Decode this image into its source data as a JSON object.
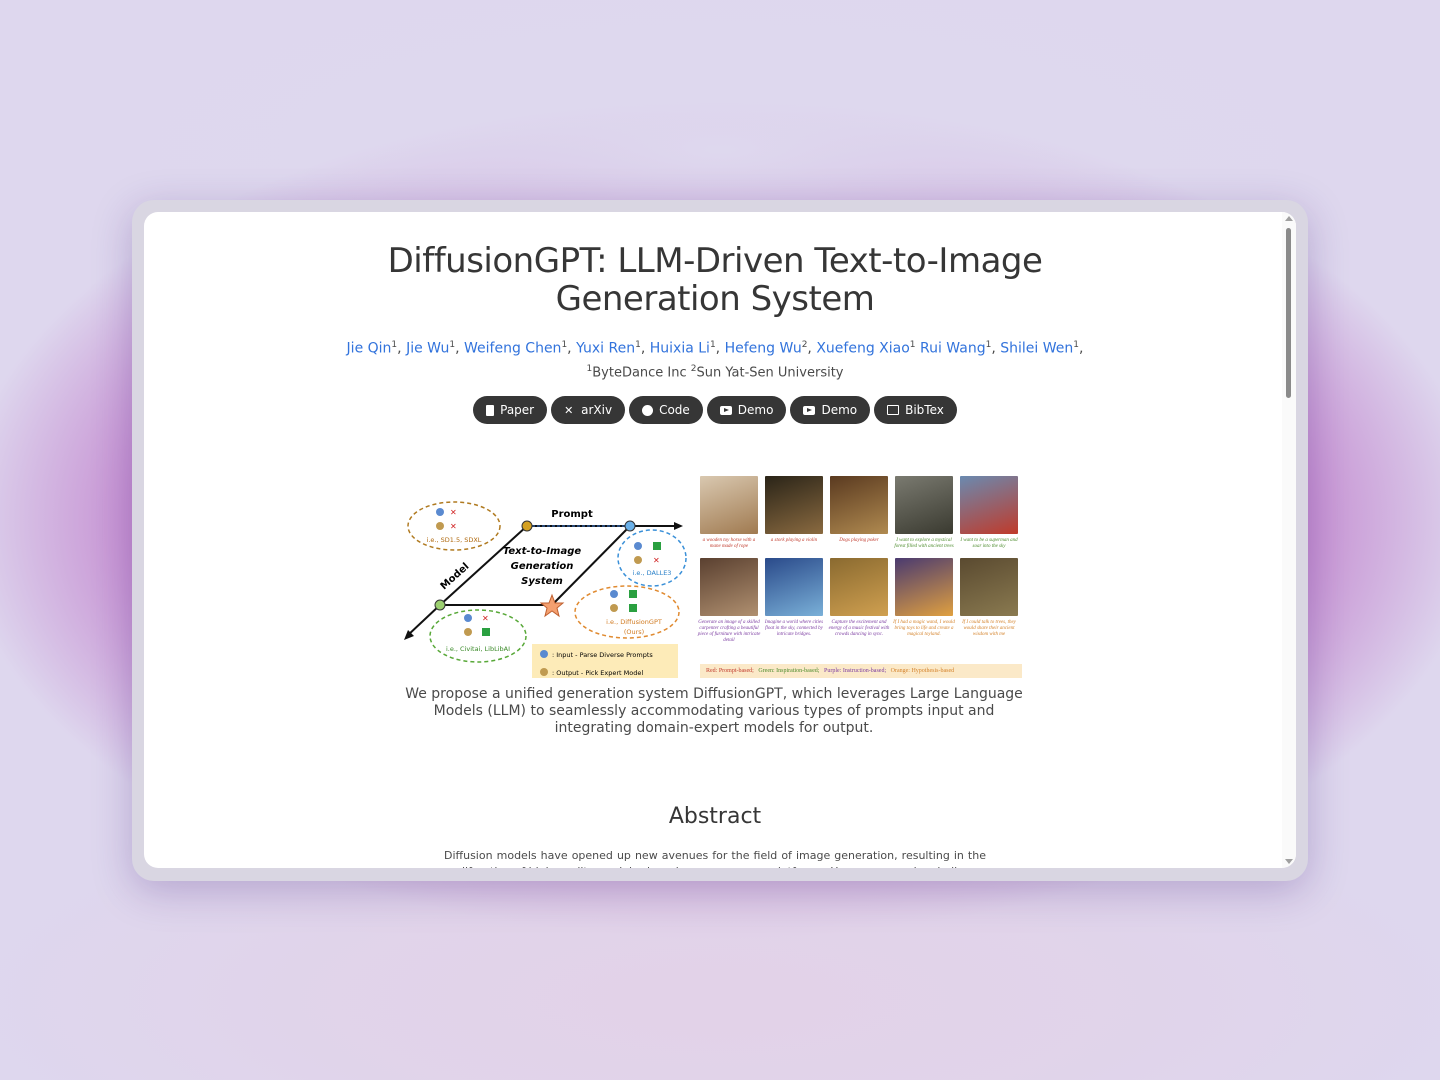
{
  "page": {
    "title_line1": "DiffusionGPT: LLM-Driven Text-to-Image",
    "title_line2": "Generation System",
    "authors": [
      {
        "name": "Jie Qin",
        "sup": "1",
        "sep": ", "
      },
      {
        "name": "Jie Wu",
        "sup": "1",
        "sep": ", "
      },
      {
        "name": "Weifeng Chen",
        "sup": "1",
        "sep": ", "
      },
      {
        "name": "Yuxi Ren",
        "sup": "1",
        "sep": ", "
      },
      {
        "name": "Huixia Li",
        "sup": "1",
        "sep": ", "
      },
      {
        "name": "Hefeng Wu",
        "sup": "2",
        "sep": ", "
      },
      {
        "name": "Xuefeng Xiao",
        "sup": "1",
        "sep": " "
      },
      {
        "name": "Rui Wang",
        "sup": "1",
        "sep": ", "
      },
      {
        "name": "Shilei Wen",
        "sup": "1",
        "sep": ","
      }
    ],
    "affiliations": [
      {
        "sup": "1",
        "name": "ByteDance Inc "
      },
      {
        "sup": "2",
        "name": "Sun Yat-Sen University"
      }
    ],
    "links": [
      {
        "label": "Paper",
        "icon": "file-pdf-icon"
      },
      {
        "label": "arXiv",
        "icon": "arxiv-icon"
      },
      {
        "label": "Code",
        "icon": "github-icon"
      },
      {
        "label": "Demo",
        "icon": "youtube-icon"
      },
      {
        "label": "Demo",
        "icon": "youtube-icon"
      },
      {
        "label": "BibTex",
        "icon": "images-icon"
      }
    ],
    "caption": "We propose a unified generation system DiffusionGPT, which leverages Large Language Models (LLM) to seamlessly accommodating various types of prompts input and integrating domain-expert models for output.",
    "abstract_heading": "Abstract",
    "abstract_text": "Diffusion models have opened up new avenues for the field of image generation, resulting in the proliferation of high-quality models shared on open-source platforms. However, a major challenge"
  },
  "figure": {
    "diagram": {
      "prompt": "Prompt",
      "model": "Model",
      "system_line1": "Text-to-Image",
      "system_line2": "Generation",
      "system_line3": "System",
      "ie_sd": "i.e., SD1.5, SDXL",
      "ie_dalle": "i.e., DALLE3",
      "ie_ours_1": "i.e., DiffusionGPT",
      "ie_ours_2": "(Ours)",
      "ie_civitai": "i.e., Civitai, LibLibAI",
      "legend_input": ": Input - Parse Diverse Prompts",
      "legend_output": ": Output - Pick Expert Model"
    },
    "thumbnails_row1": [
      {
        "caption": "a wooden toy horse with a mane made of rope",
        "color": "#c0392b"
      },
      {
        "caption": "a stork playing a violin",
        "color": "#c0392b"
      },
      {
        "caption": "Dogs playing poker",
        "color": "#c0392b"
      },
      {
        "caption": "I want to explore a mystical forest filled with ancient trees",
        "color": "#4a8a2a"
      },
      {
        "caption": "I want to be a superman and soar into the sky",
        "color": "#4a8a2a"
      }
    ],
    "thumbnails_row2": [
      {
        "caption": "Generate an image of a skilled carpenter crafting a beautiful piece of furniture with intricate detail",
        "color": "#7a3aa0"
      },
      {
        "caption": "Imagine a world where cities float in the sky, connected by intricate bridges.",
        "color": "#7a3aa0"
      },
      {
        "caption": "Capture the excitement and energy of a music festival with crowds dancing in sync.",
        "color": "#7a3aa0"
      },
      {
        "caption": "If I had a magic wand, I would bring toys to life and create a magical toyland.",
        "color": "#d4822a"
      },
      {
        "caption": "If I could talk to trees, they would share their ancient wisdom with me",
        "color": "#d4822a"
      }
    ],
    "legend": {
      "red": "Red: Prompt-based;",
      "green": "Green: Inspiration-based;",
      "purple": "Purple: Instruction-based;",
      "orange": "Orange: Hypothesis-based"
    }
  }
}
